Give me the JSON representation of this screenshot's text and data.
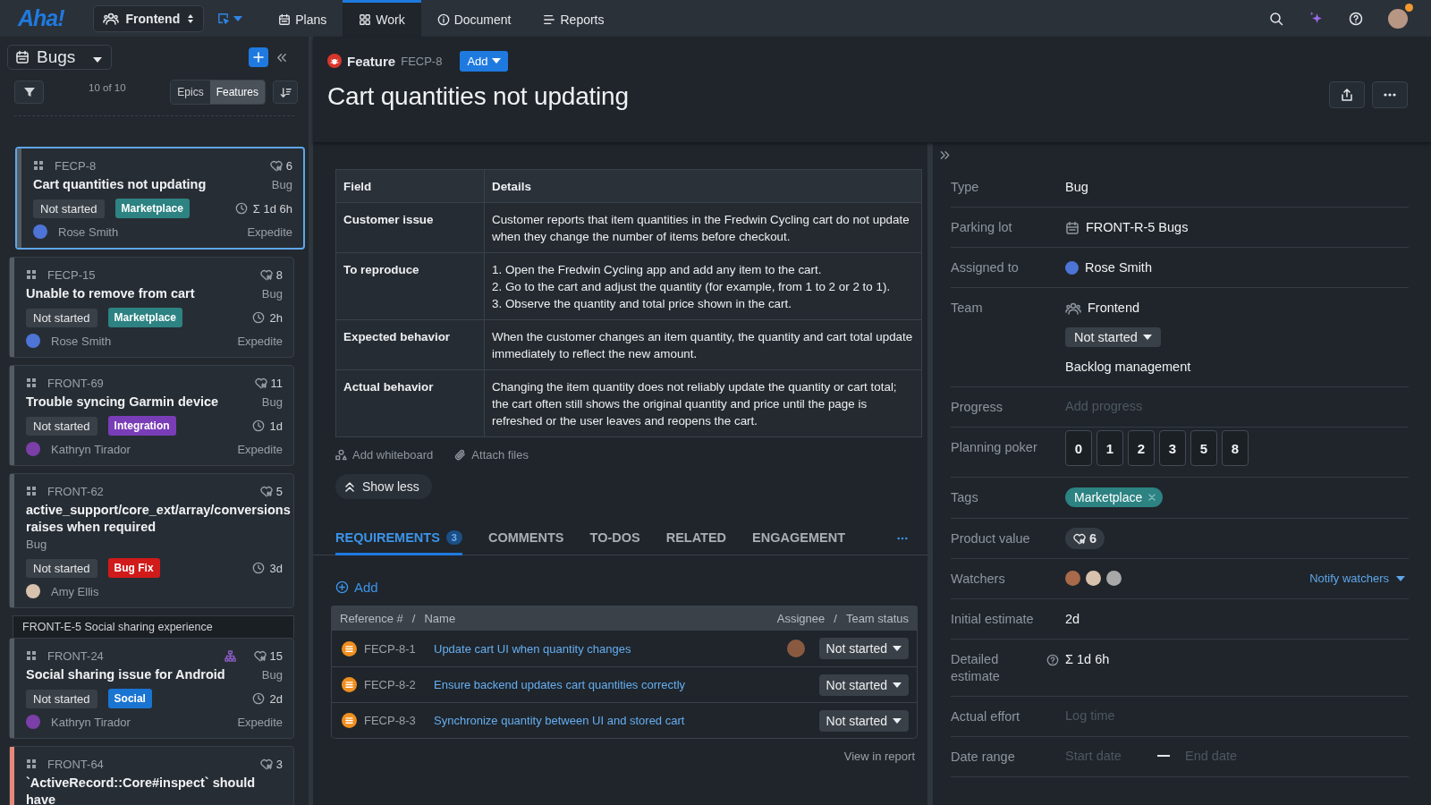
{
  "topbar": {
    "logo": "Aha!",
    "team": "Frontend",
    "nav": [
      {
        "label": "Plans",
        "selected": false
      },
      {
        "label": "Work",
        "selected": true
      },
      {
        "label": "Document",
        "selected": false
      },
      {
        "label": "Reports",
        "selected": false
      }
    ],
    "notification": true
  },
  "sidebar": {
    "view": "Bugs",
    "count": "10 of 10",
    "toggle": [
      {
        "label": "Epics",
        "selected": false
      },
      {
        "label": "Features",
        "selected": true
      }
    ],
    "items": [
      {
        "kind": "card",
        "selected": true,
        "color": "#555c64",
        "ref": "FECP-8",
        "score": "6",
        "hierarchy": false,
        "title": "Cart quantities not updating",
        "type": "Bug",
        "status": "Not started",
        "tag": {
          "label": "Marketplace",
          "color": "#2d8282"
        },
        "estimate": "Σ 1d 6h",
        "assignee": {
          "name": "Rose Smith",
          "color": "#4d74d6"
        },
        "priority": "Expedite"
      },
      {
        "kind": "card",
        "selected": false,
        "color": "#555c64",
        "ref": "FECP-15",
        "score": "8",
        "hierarchy": false,
        "title": "Unable to remove from cart",
        "type": "Bug",
        "status": "Not started",
        "tag": {
          "label": "Marketplace",
          "color": "#2d8282"
        },
        "estimate": "2h",
        "assignee": {
          "name": "Rose Smith",
          "color": "#4d74d6"
        },
        "priority": "Expedite"
      },
      {
        "kind": "card",
        "selected": false,
        "color": "#555c64",
        "ref": "FRONT-69",
        "score": "11",
        "hierarchy": false,
        "title": "Trouble syncing Garmin device",
        "type": "Bug",
        "status": "Not started",
        "tag": {
          "label": "Integration",
          "color": "#7a3db8"
        },
        "estimate": "1d",
        "assignee": {
          "name": "Kathryn Tirador",
          "color": "#7b3fa8"
        },
        "priority": "Expedite"
      },
      {
        "kind": "card",
        "selected": false,
        "color": "#555c64",
        "ref": "FRONT-62",
        "score": "5",
        "hierarchy": false,
        "title": "active_support/core_ext/array/conversions raises when required",
        "type": "Bug",
        "status": "Not started",
        "tag": {
          "label": "Bug Fix",
          "color": "#d11a1a"
        },
        "estimate": "3d",
        "assignee": {
          "name": "Amy Ellis",
          "color": "#d8c2ae"
        }
      },
      {
        "kind": "group",
        "label": "FRONT-E-5 Social sharing experience"
      },
      {
        "kind": "card",
        "selected": false,
        "color": "#555c64",
        "ref": "FRONT-24",
        "score": "15",
        "hierarchy": true,
        "title": "Social sharing issue for Android",
        "type": "Bug",
        "status": "Not started",
        "tag": {
          "label": "Social",
          "color": "#1a74d2"
        },
        "estimate": "2d",
        "assignee": {
          "name": "Kathryn Tirador",
          "color": "#7b3fa8"
        },
        "priority": "Expedite"
      },
      {
        "kind": "card",
        "selected": false,
        "color": "#e8877c",
        "ref": "FRONT-64",
        "score": "3",
        "hierarchy": false,
        "title": "`ActiveRecord::Core#inspect` should have"
      }
    ]
  },
  "feature": {
    "type": "Feature",
    "ref": "FECP-8",
    "add": "Add",
    "title": "Cart quantities not updating"
  },
  "description": {
    "columns": [
      "Field",
      "Details"
    ],
    "rows": [
      {
        "field": "Customer issue",
        "details": [
          "Customer reports that item quantities in the Fredwin Cycling cart do not update when they change the number of items before checkout."
        ]
      },
      {
        "field": "To reproduce",
        "details": [
          "1. Open the Fredwin Cycling app and add any item to the cart.",
          "2. Go to the cart and adjust the quantity (for example, from 1 to 2 or 2 to 1).",
          "3. Observe the quantity and total price shown in the cart."
        ]
      },
      {
        "field": "Expected behavior",
        "details": [
          "When the customer changes an item quantity, the quantity and cart total update immediately to reflect the new amount."
        ]
      },
      {
        "field": "Actual behavior",
        "details": [
          "Changing the item quantity does not reliably update the quantity or cart total; the cart often still shows the original quantity and price until the page is refreshed or the user leaves and reopens the cart."
        ]
      }
    ]
  },
  "attachments": [
    "Add whiteboard",
    "Attach files"
  ],
  "show_less": "Show less",
  "tabs": [
    {
      "label": "REQUIREMENTS",
      "count": "3",
      "selected": true
    },
    {
      "label": "COMMENTS",
      "selected": false
    },
    {
      "label": "TO-DOS",
      "selected": false
    },
    {
      "label": "RELATED",
      "selected": false
    },
    {
      "label": "ENGAGEMENT",
      "selected": false
    }
  ],
  "requirements": {
    "add": "Add",
    "header": {
      "left": [
        "Reference #",
        "/",
        "Name"
      ],
      "right": [
        "Assignee",
        "/",
        "Team status"
      ]
    },
    "rows": [
      {
        "ref": "FECP-8-1",
        "name": "Update cart UI when quantity changes",
        "assignee": {
          "color": "#8a5a40"
        },
        "status": "Not started"
      },
      {
        "ref": "FECP-8-2",
        "name": "Ensure backend updates cart quantities correctly",
        "status": "Not started"
      },
      {
        "ref": "FECP-8-3",
        "name": "Synchronize quantity between UI and stored cart",
        "status": "Not started"
      }
    ],
    "report": "View in report"
  },
  "details": [
    {
      "label": "Type",
      "kind": "text",
      "value": "Bug"
    },
    {
      "label": "Parking lot",
      "kind": "release",
      "value": "FRONT-R-5 Bugs"
    },
    {
      "label": "Assigned to",
      "kind": "user",
      "value": "Rose Smith",
      "color": "#4d74d6"
    },
    {
      "label": "Team",
      "kind": "team",
      "value": "Frontend",
      "status": "Not started",
      "workflow": "Backlog management"
    },
    {
      "label": "Progress",
      "kind": "input",
      "placeholder": "Add progress"
    },
    {
      "label": "Planning poker",
      "kind": "poker",
      "cards": [
        "0",
        "1",
        "2",
        "3",
        "5",
        "8"
      ]
    },
    {
      "label": "Tags",
      "kind": "tags",
      "tags": [
        {
          "label": "Marketplace",
          "color": "#2d8282"
        }
      ]
    },
    {
      "label": "Product value",
      "kind": "score",
      "value": "6"
    },
    {
      "label": "Watchers",
      "kind": "watchers",
      "avatars": [
        {
          "color": "#a86a4a"
        },
        {
          "color": "#d8c2ae"
        },
        {
          "color": "#a8a8a8"
        }
      ],
      "action": "Notify watchers"
    },
    {
      "label": "Initial estimate",
      "kind": "text",
      "value": "2d"
    },
    {
      "label": "Detailed estimate",
      "kind": "estimate",
      "value": "Σ 1d 6h"
    },
    {
      "label": "Actual effort",
      "kind": "input",
      "placeholder": "Log time"
    },
    {
      "label": "Date range",
      "kind": "range",
      "fields": [
        {
          "placeholder": "Start date"
        },
        {
          "placeholder": "End date"
        }
      ]
    }
  ]
}
